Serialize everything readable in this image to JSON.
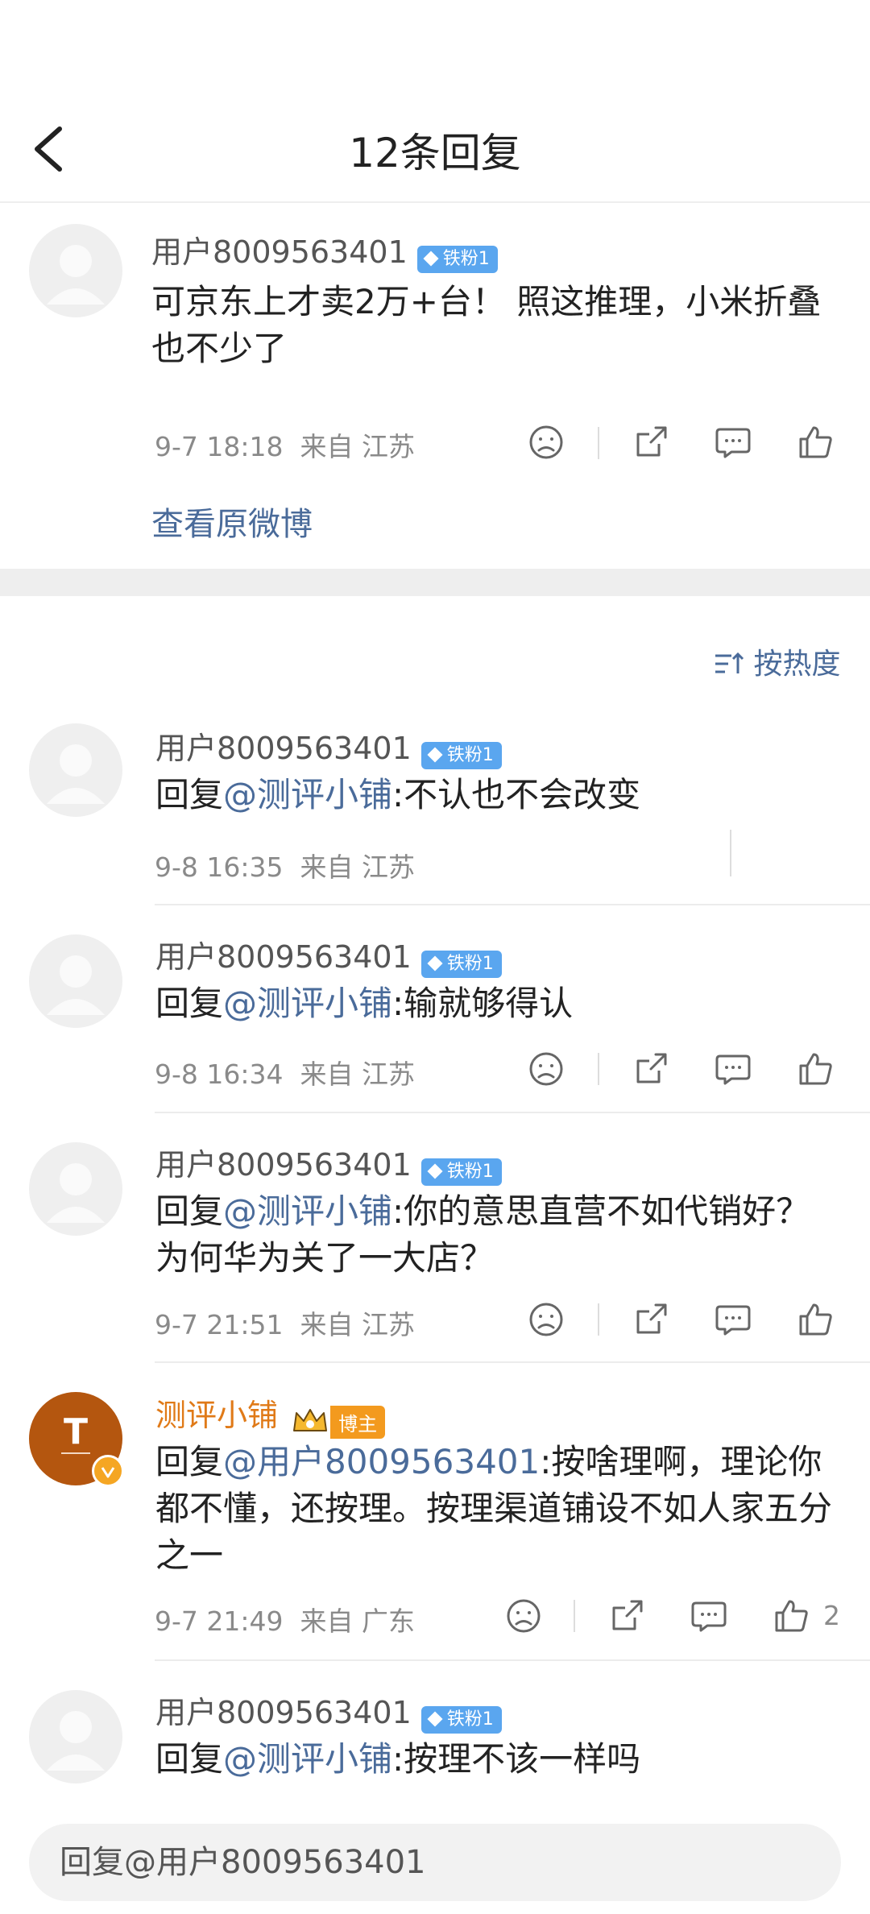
{
  "header": {
    "title": "12条回复"
  },
  "main_comment": {
    "username": "用户8009563401",
    "badge": "铁粉1",
    "text": "可京东上才卖2万+台！ 照这推理，小米折叠也不少了",
    "time": "9-7 18:18",
    "location": "来自 江苏",
    "view_original": "查看原微博"
  },
  "sort": {
    "label": "按热度"
  },
  "replies": [
    {
      "username": "用户8009563401",
      "badge": "铁粉1",
      "prefix": "回复",
      "mention": "@测评小铺",
      "body": ":不认也不会改变",
      "time": "9-8 16:35",
      "location": "来自 江苏"
    },
    {
      "username": "用户8009563401",
      "badge": "铁粉1",
      "prefix": "回复",
      "mention": "@测评小铺",
      "body": ":输就够得认",
      "time": "9-8 16:34",
      "location": "来自 江苏"
    },
    {
      "username": "用户8009563401",
      "badge": "铁粉1",
      "prefix": "回复",
      "mention": "@测评小铺",
      "body": ":你的意思直营不如代销好？为何华为关了一大店？",
      "time": "9-7 21:51",
      "location": "来自 江苏"
    },
    {
      "username": "测评小铺",
      "badge": "博主",
      "prefix": "回复",
      "mention": "@用户8009563401",
      "body": ":按啥理啊，理论你都不懂，还按理。按理渠道铺设不如人家五分之一",
      "time": "9-7 21:49",
      "location": "来自 广东",
      "likes": "2"
    },
    {
      "username": "用户8009563401",
      "badge": "铁粉1",
      "prefix": "回复",
      "mention": "@测评小铺",
      "body": ":按理不该一样吗"
    }
  ],
  "reply_box": {
    "value": "回复@用户8009563401"
  },
  "colors": {
    "mention": "#4a6b9a",
    "author": "#e07a18",
    "badge": "#5aa6ef",
    "blogger": "#f39a1e"
  },
  "icons": [
    "back-arrow-icon",
    "dislike-icon",
    "share-icon",
    "comment-icon",
    "like-icon",
    "sort-icon",
    "verified-icon",
    "crown-icon"
  ]
}
